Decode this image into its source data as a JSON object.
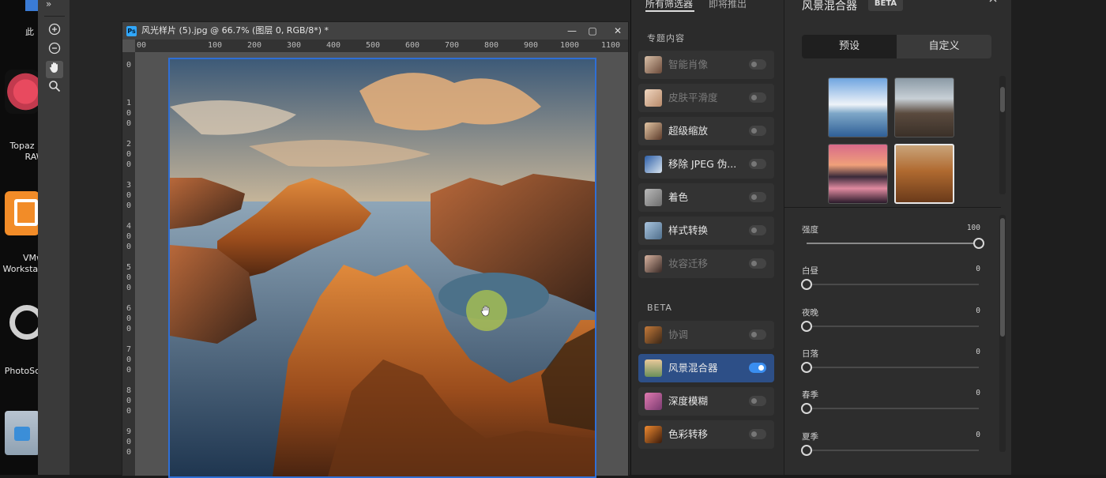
{
  "desktop": {
    "icons": [
      {
        "name": "topaz-raw",
        "label_line1": "Topaz",
        "label_line2": "RAW"
      },
      {
        "name": "vmware",
        "label_line1": "VMw",
        "label_line2": "Workstat"
      },
      {
        "name": "photoscape",
        "label_line1": "PhotoSc",
        "label_line2": ""
      },
      {
        "name": "recycle-bin",
        "label_line1": "",
        "label_line2": ""
      }
    ],
    "top_label": "此"
  },
  "toolbar": {
    "collapse": "»"
  },
  "document": {
    "title": "风光样片 (5).jpg @ 66.7% (图层 0, RGB/8*) *",
    "ps_badge": "Ps",
    "hruler_ticks": [
      "00",
      "100",
      "200",
      "300",
      "400",
      "500",
      "600",
      "700",
      "800",
      "900",
      "1000",
      "1100"
    ],
    "vruler_ticks": [
      "0",
      "1\n0\n0",
      "2\n0\n0",
      "3\n0\n0",
      "4\n0\n0",
      "5\n0\n0",
      "6\n0\n0",
      "7\n0\n0",
      "8\n0\n0",
      "9\n0\n0"
    ]
  },
  "filters": {
    "tab_all": "所有筛选器",
    "tab_coming": "即将推出",
    "section_featured": "专题内容",
    "section_beta": "BETA",
    "featured": [
      {
        "label": "智能肖像",
        "enabled": false,
        "dim": true
      },
      {
        "label": "皮肤平滑度",
        "enabled": false,
        "dim": true
      },
      {
        "label": "超级缩放",
        "enabled": false,
        "dim": false
      },
      {
        "label": "移除 JPEG 伪...",
        "enabled": false,
        "dim": false
      },
      {
        "label": "着色",
        "enabled": false,
        "dim": false
      },
      {
        "label": "样式转换",
        "enabled": false,
        "dim": false
      },
      {
        "label": "妆容迁移",
        "enabled": false,
        "dim": true
      }
    ],
    "beta": [
      {
        "label": "协调",
        "enabled": false,
        "dim": true
      },
      {
        "label": "风景混合器",
        "enabled": true,
        "dim": false,
        "active": true
      },
      {
        "label": "深度模糊",
        "enabled": false,
        "dim": false
      },
      {
        "label": "色彩转移",
        "enabled": false,
        "dim": false
      }
    ]
  },
  "panel": {
    "title": "风景混合器",
    "badge": "BETA",
    "tab_presets": "预设",
    "tab_custom": "自定义",
    "sliders": [
      {
        "label": "强度",
        "value": "100",
        "level": 1.0
      },
      {
        "label": "白昼",
        "value": "0",
        "level": 0
      },
      {
        "label": "夜晚",
        "value": "0",
        "level": 0
      },
      {
        "label": "日落",
        "value": "0",
        "level": 0
      },
      {
        "label": "春季",
        "value": "0",
        "level": 0
      },
      {
        "label": "夏季",
        "value": "0",
        "level": 0
      }
    ]
  },
  "colors": {
    "accent": "#3a8ef0",
    "active_item": "#2d4f87",
    "selection_border": "#2f6fd6"
  }
}
